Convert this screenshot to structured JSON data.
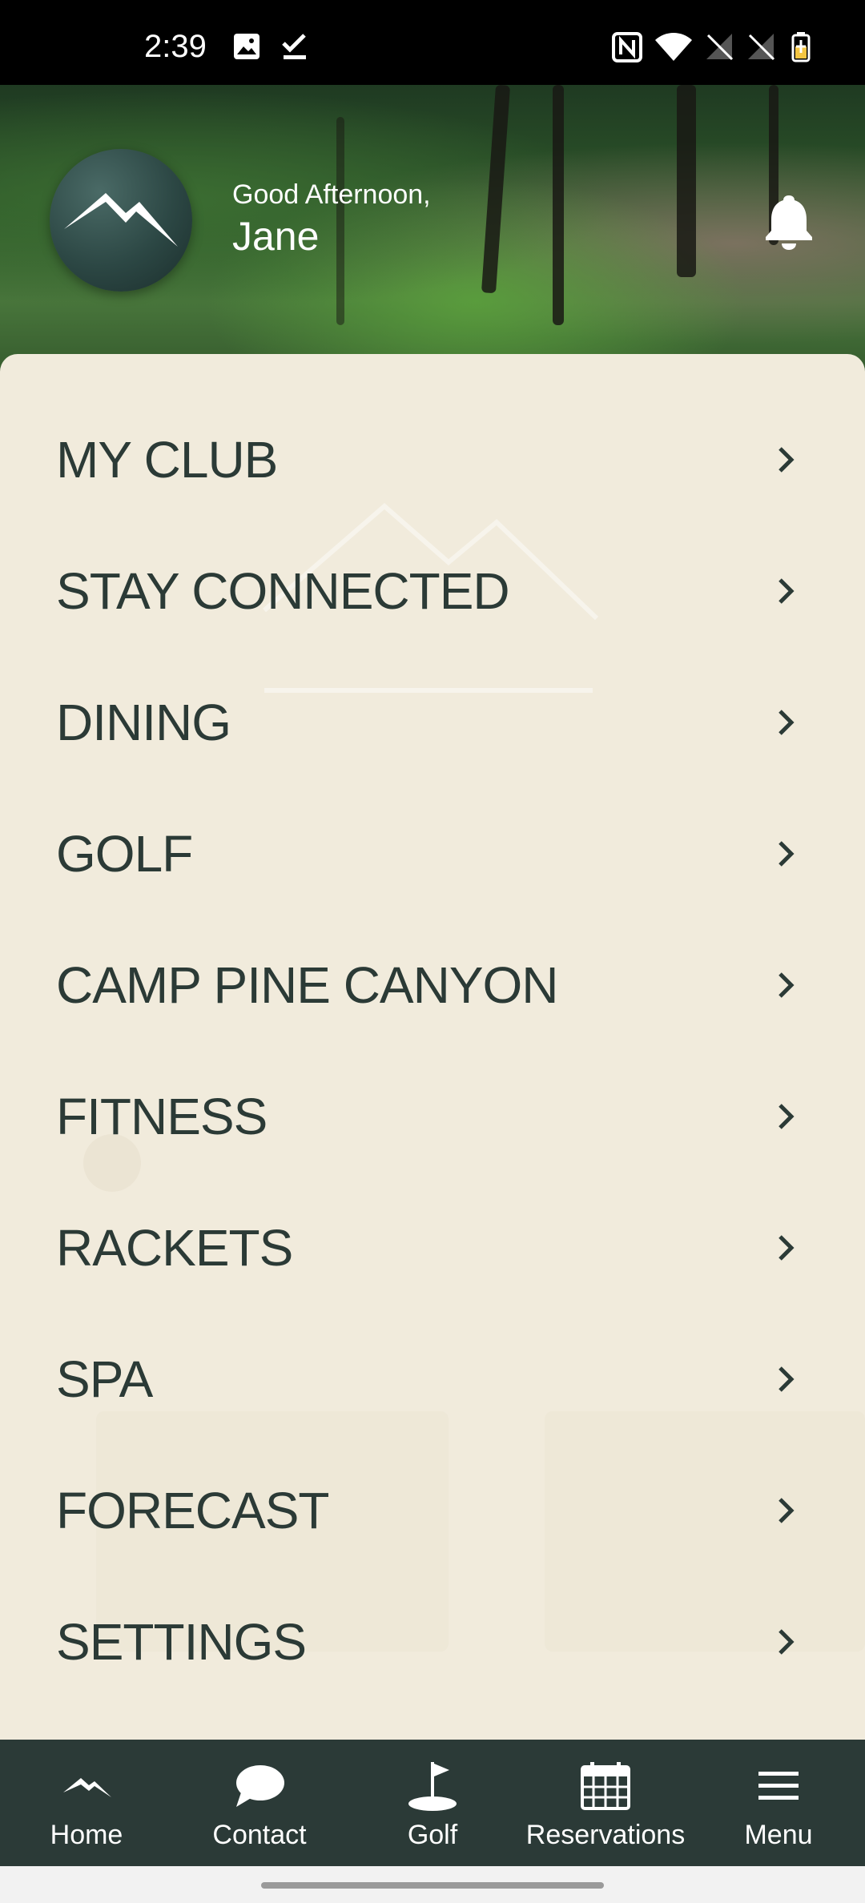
{
  "status_bar": {
    "time": "2:39",
    "left_icons": [
      "image-icon",
      "check-icon"
    ],
    "right_icons": [
      "nfc-icon",
      "wifi-icon",
      "no-signal-icon",
      "no-signal-icon",
      "battery-charging-icon"
    ]
  },
  "header": {
    "greeting": "Good Afternoon,",
    "user_name": "Jane",
    "avatar_icon": "mountain-logo-icon",
    "notification_icon": "bell-icon"
  },
  "menu": {
    "items": [
      {
        "label": "MY CLUB"
      },
      {
        "label": "STAY CONNECTED"
      },
      {
        "label": "DINING"
      },
      {
        "label": "GOLF"
      },
      {
        "label": "CAMP PINE CANYON"
      },
      {
        "label": "FITNESS"
      },
      {
        "label": "RACKETS"
      },
      {
        "label": "SPA"
      },
      {
        "label": "FORECAST"
      },
      {
        "label": "SETTINGS"
      }
    ]
  },
  "bottom_nav": {
    "items": [
      {
        "label": "Home",
        "icon": "mountain-icon"
      },
      {
        "label": "Contact",
        "icon": "chat-bubble-icon"
      },
      {
        "label": "Golf",
        "icon": "golf-flag-icon"
      },
      {
        "label": "Reservations",
        "icon": "calendar-icon"
      },
      {
        "label": "Menu",
        "icon": "hamburger-menu-icon"
      }
    ]
  },
  "colors": {
    "sheet_background": "#f1ebdc",
    "menu_text": "#2b3a36",
    "nav_background": "#2b3a37"
  }
}
